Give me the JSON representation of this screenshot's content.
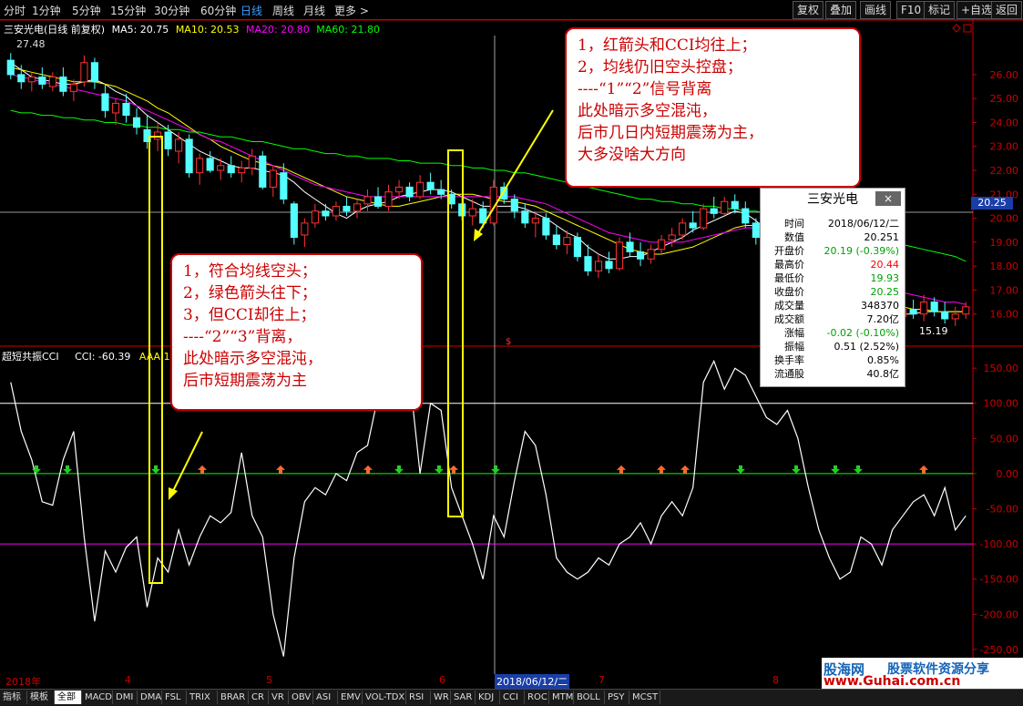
{
  "toolbar": {
    "periods": [
      "分时",
      "1分钟",
      "5分钟",
      "15分钟",
      "30分钟",
      "60分钟",
      "日线",
      "周线",
      "月线",
      "更多 >"
    ],
    "active_period": "日线",
    "buttons": [
      "复权",
      "叠加",
      "画线",
      "F10",
      "标记",
      "+自选",
      "返回"
    ]
  },
  "stock_info": {
    "name_label": "三安光电(日线 前复权)",
    "ma5": "MA5: 20.75",
    "ma10": "MA10: 20.53",
    "ma20": "MA20: 20.80",
    "ma60": "MA60: 21.80",
    "high_mark": "27.48",
    "low_mark": "15.19",
    "current_price": "20.25",
    "arrow_marker": "$"
  },
  "colors": {
    "up": "#ff3232",
    "down": "#54ffff",
    "ma5": "#ffffff",
    "ma10": "#ffff00",
    "ma20": "#ff00ff",
    "ma60": "#00ff00",
    "cci": "#ffffff",
    "note_border": "#cc0000",
    "highlight": "#ffff00"
  },
  "price_axis": [
    "26.00",
    "25.00",
    "24.00",
    "23.00",
    "22.00",
    "21.00",
    "20.00",
    "19.00",
    "18.00",
    "17.00",
    "16.00"
  ],
  "indicator": {
    "name": "超短共振CCI",
    "cci_value": "CCI: -60.39",
    "aaa_value": "AAA:1",
    "axis": [
      "150.00",
      "100.00",
      "50.00",
      "0.00",
      "-50.00",
      "-100.00",
      "-150.00",
      "-200.00",
      "-250.00"
    ]
  },
  "chart_data": {
    "type": "candlestick+line",
    "price_range": [
      15,
      27.48
    ],
    "cci_range": [
      -280,
      180
    ],
    "cci_reference_lines": [
      100,
      0,
      -100
    ],
    "candles": [
      [
        26.6,
        26.9,
        25.8,
        26.0
      ],
      [
        26.0,
        26.4,
        25.4,
        25.7
      ],
      [
        25.7,
        26.1,
        25.3,
        25.9
      ],
      [
        25.9,
        26.3,
        25.4,
        25.6
      ],
      [
        25.5,
        26.1,
        25.3,
        25.9
      ],
      [
        25.9,
        26.3,
        25.1,
        25.3
      ],
      [
        25.3,
        25.8,
        24.9,
        25.6
      ],
      [
        25.7,
        26.8,
        25.5,
        26.5
      ],
      [
        26.5,
        26.7,
        25.4,
        25.7
      ],
      [
        25.2,
        25.6,
        24.2,
        24.5
      ],
      [
        24.4,
        25.0,
        23.9,
        24.8
      ],
      [
        24.8,
        25.2,
        24.0,
        24.3
      ],
      [
        24.2,
        24.6,
        23.5,
        23.8
      ],
      [
        23.7,
        24.3,
        22.9,
        23.2
      ],
      [
        23.3,
        24.0,
        22.8,
        23.6
      ],
      [
        23.6,
        23.9,
        22.6,
        22.9
      ],
      [
        22.8,
        23.6,
        22.3,
        23.3
      ],
      [
        23.3,
        23.5,
        21.7,
        21.9
      ],
      [
        21.9,
        22.7,
        21.4,
        22.5
      ],
      [
        22.5,
        22.8,
        21.9,
        22.0
      ],
      [
        22.0,
        22.5,
        21.6,
        22.2
      ],
      [
        22.2,
        22.6,
        21.7,
        21.9
      ],
      [
        21.9,
        22.4,
        21.5,
        22.1
      ],
      [
        22.1,
        22.9,
        21.8,
        22.6
      ],
      [
        22.6,
        22.8,
        21.2,
        21.3
      ],
      [
        21.3,
        22.2,
        20.9,
        22.0
      ],
      [
        21.9,
        22.3,
        20.6,
        20.8
      ],
      [
        20.6,
        20.7,
        18.9,
        19.2
      ],
      [
        19.3,
        20.0,
        18.8,
        19.8
      ],
      [
        19.8,
        20.6,
        19.6,
        20.3
      ],
      [
        20.3,
        20.6,
        19.9,
        20.1
      ],
      [
        20.1,
        20.7,
        19.9,
        20.5
      ],
      [
        20.5,
        20.9,
        20.1,
        20.3
      ],
      [
        20.3,
        20.8,
        20.0,
        20.6
      ],
      [
        20.6,
        21.2,
        20.3,
        20.9
      ],
      [
        20.9,
        21.3,
        20.4,
        20.5
      ],
      [
        20.5,
        21.4,
        20.3,
        21.1
      ],
      [
        21.1,
        21.6,
        20.8,
        21.3
      ],
      [
        21.3,
        21.5,
        20.7,
        20.9
      ],
      [
        20.9,
        21.8,
        20.8,
        21.5
      ],
      [
        21.5,
        21.9,
        21.0,
        21.2
      ],
      [
        21.2,
        21.6,
        20.8,
        21.0
      ],
      [
        21.0,
        21.2,
        20.4,
        20.6
      ],
      [
        20.6,
        20.9,
        19.9,
        20.1
      ],
      [
        20.1,
        20.8,
        19.7,
        20.4
      ],
      [
        20.4,
        20.7,
        19.6,
        19.8
      ],
      [
        19.8,
        21.6,
        19.7,
        21.3
      ],
      [
        21.3,
        21.5,
        20.6,
        20.8
      ],
      [
        20.8,
        21.0,
        20.0,
        20.3
      ],
      [
        20.3,
        20.6,
        19.6,
        19.8
      ],
      [
        19.8,
        20.3,
        19.2,
        20.0
      ],
      [
        20.0,
        20.2,
        19.1,
        19.3
      ],
      [
        19.3,
        19.7,
        18.7,
        18.9
      ],
      [
        18.9,
        19.5,
        18.5,
        19.2
      ],
      [
        19.2,
        19.4,
        18.2,
        18.4
      ],
      [
        18.4,
        18.9,
        17.6,
        17.8
      ],
      [
        17.8,
        18.5,
        17.5,
        18.2
      ],
      [
        18.2,
        18.6,
        17.7,
        17.9
      ],
      [
        17.9,
        19.2,
        17.8,
        19.0
      ],
      [
        19.0,
        19.4,
        18.4,
        18.6
      ],
      [
        18.6,
        19.0,
        18.0,
        18.3
      ],
      [
        18.3,
        18.9,
        18.1,
        18.7
      ],
      [
        18.7,
        19.3,
        18.5,
        19.1
      ],
      [
        19.1,
        19.6,
        18.8,
        19.3
      ],
      [
        19.3,
        20.0,
        19.1,
        19.8
      ],
      [
        19.8,
        20.3,
        19.4,
        19.6
      ],
      [
        19.6,
        20.6,
        19.5,
        20.4
      ],
      [
        20.4,
        20.9,
        20.0,
        20.2
      ],
      [
        20.2,
        20.9,
        20.1,
        20.7
      ],
      [
        20.7,
        21.0,
        20.2,
        20.4
      ],
      [
        20.4,
        20.7,
        19.6,
        19.8
      ],
      [
        19.8,
        20.0,
        18.9,
        19.2
      ],
      [
        19.2,
        19.6,
        17.9,
        18.1
      ],
      [
        18.1,
        18.6,
        17.1,
        17.4
      ],
      [
        17.4,
        17.9,
        16.6,
        16.9
      ],
      [
        16.9,
        17.4,
        16.2,
        16.5
      ],
      [
        16.5,
        17.0,
        15.8,
        16.2
      ],
      [
        16.2,
        16.9,
        15.6,
        16.6
      ],
      [
        16.6,
        17.1,
        16.0,
        16.4
      ],
      [
        16.4,
        16.8,
        15.4,
        15.9
      ],
      [
        15.9,
        16.5,
        15.5,
        16.3
      ],
      [
        16.3,
        16.9,
        15.6,
        16.1
      ],
      [
        16.1,
        16.7,
        15.4,
        16.4
      ],
      [
        16.4,
        16.6,
        15.2,
        15.6
      ],
      [
        15.6,
        16.2,
        15.4,
        15.9
      ],
      [
        15.9,
        16.5,
        15.7,
        16.2
      ],
      [
        16.2,
        16.6,
        15.8,
        16.0
      ],
      [
        16.0,
        16.8,
        15.7,
        16.5
      ],
      [
        16.5,
        16.7,
        15.9,
        16.1
      ],
      [
        16.1,
        16.5,
        15.6,
        15.8
      ],
      [
        15.8,
        16.3,
        15.5,
        16.0
      ],
      [
        16.0,
        16.5,
        15.8,
        16.3
      ]
    ],
    "ma_series": [
      {
        "name": "MA5",
        "values": [
          26.5,
          26.2,
          25.9,
          25.8,
          25.7,
          25.6,
          25.6,
          25.7,
          25.8,
          25.6,
          25.3,
          25.1,
          24.7,
          24.3,
          24.0,
          23.7,
          23.4,
          23.1,
          22.8,
          22.6,
          22.4,
          22.2,
          22.1,
          22.1,
          22.0,
          21.9,
          21.8,
          21.5,
          21.1,
          20.8,
          20.5,
          20.2,
          20.0,
          20.3,
          20.5,
          20.6,
          20.7,
          20.9,
          21.0,
          21.1,
          21.2,
          21.2,
          21.1,
          20.9,
          20.7,
          20.5,
          20.5,
          20.5,
          20.5,
          20.4,
          20.2,
          20.0,
          19.7,
          19.4,
          19.2,
          18.8,
          18.5,
          18.3,
          18.3,
          18.4,
          18.4,
          18.6,
          18.8,
          19.0,
          19.2,
          19.5,
          19.7,
          19.9,
          20.1,
          20.3,
          20.2,
          19.9,
          19.5,
          19.0,
          18.4,
          17.9,
          17.3,
          16.9,
          16.6,
          16.4,
          16.3,
          16.3,
          16.2,
          16.1,
          16.0,
          16.0,
          16.0,
          16.1,
          16.1,
          16.1,
          16.1,
          16.1
        ]
      },
      {
        "name": "MA10",
        "values": [
          26.3,
          26.2,
          26.1,
          26.0,
          25.9,
          25.8,
          25.7,
          25.7,
          25.7,
          25.6,
          25.5,
          25.3,
          25.1,
          24.9,
          24.6,
          24.4,
          24.1,
          23.8,
          23.5,
          23.3,
          23.0,
          22.8,
          22.6,
          22.4,
          22.3,
          22.2,
          22.1,
          21.9,
          21.7,
          21.5,
          21.3,
          21.1,
          20.9,
          20.8,
          20.7,
          20.6,
          20.5,
          20.5,
          20.6,
          20.7,
          20.8,
          20.9,
          21.0,
          21.0,
          21.0,
          20.9,
          20.8,
          20.7,
          20.7,
          20.6,
          20.5,
          20.3,
          20.1,
          19.9,
          19.7,
          19.5,
          19.3,
          19.1,
          18.9,
          18.7,
          18.6,
          18.5,
          18.5,
          18.6,
          18.7,
          18.8,
          19.0,
          19.2,
          19.4,
          19.6,
          19.7,
          19.7,
          19.6,
          19.5,
          19.3,
          19.0,
          18.7,
          18.3,
          17.9,
          17.5,
          17.2,
          16.9,
          16.7,
          16.5,
          16.4,
          16.3,
          16.2,
          16.2,
          16.1,
          16.1,
          16.1,
          16.1
        ]
      },
      {
        "name": "MA20",
        "values": [
          26.0,
          25.9,
          25.8,
          25.7,
          25.6,
          25.5,
          25.4,
          25.3,
          25.2,
          25.1,
          25.0,
          24.9,
          24.7,
          24.5,
          24.3,
          24.1,
          23.9,
          23.7,
          23.5,
          23.3,
          23.2,
          23.0,
          22.8,
          22.6,
          22.4,
          22.2,
          22.0,
          21.8,
          21.6,
          21.4,
          21.3,
          21.2,
          21.1,
          21.0,
          20.9,
          20.9,
          20.9,
          20.9,
          20.9,
          20.9,
          20.9,
          20.9,
          20.9,
          20.9,
          20.9,
          20.9,
          20.9,
          20.9,
          20.9,
          20.8,
          20.7,
          20.6,
          20.4,
          20.2,
          20.0,
          19.8,
          19.6,
          19.4,
          19.3,
          19.2,
          19.1,
          19.0,
          19.0,
          19.0,
          19.0,
          19.1,
          19.2,
          19.3,
          19.4,
          19.5,
          19.6,
          19.6,
          19.6,
          19.5,
          19.4,
          19.2,
          19.0,
          18.8,
          18.5,
          18.2,
          17.9,
          17.6,
          17.4,
          17.2,
          17.0,
          16.9,
          16.8,
          16.7,
          16.6,
          16.5,
          16.5,
          16.4
        ]
      },
      {
        "name": "MA60",
        "values": [
          24.5,
          24.4,
          24.4,
          24.3,
          24.3,
          24.2,
          24.2,
          24.1,
          24.1,
          24.0,
          24.0,
          23.9,
          23.9,
          23.8,
          23.8,
          23.7,
          23.7,
          23.6,
          23.6,
          23.5,
          23.4,
          23.4,
          23.3,
          23.2,
          23.2,
          23.1,
          23.0,
          22.9,
          22.9,
          22.8,
          22.7,
          22.7,
          22.6,
          22.6,
          22.5,
          22.5,
          22.5,
          22.4,
          22.4,
          22.3,
          22.3,
          22.3,
          22.2,
          22.2,
          22.1,
          22.1,
          22.0,
          22.0,
          21.9,
          21.9,
          21.8,
          21.7,
          21.6,
          21.5,
          21.4,
          21.3,
          21.2,
          21.1,
          21.0,
          20.9,
          20.8,
          20.8,
          20.7,
          20.7,
          20.6,
          20.6,
          20.5,
          20.5,
          20.4,
          20.4,
          20.3,
          20.3,
          20.2,
          20.1,
          20.0,
          19.9,
          19.8,
          19.7,
          19.6,
          19.5,
          19.4,
          19.3,
          19.2,
          19.1,
          19.0,
          18.9,
          18.8,
          18.7,
          18.6,
          18.5,
          18.4,
          18.2
        ]
      }
    ],
    "cci": [
      130,
      60,
      20,
      -40,
      -45,
      20,
      60,
      -90,
      -210,
      -110,
      -140,
      -105,
      -90,
      -190,
      -120,
      -140,
      -80,
      -130,
      -90,
      -60,
      -70,
      -55,
      30,
      -60,
      -90,
      -200,
      -260,
      -120,
      -40,
      -20,
      -30,
      0,
      -10,
      30,
      40,
      110,
      130,
      100,
      140,
      0,
      100,
      90,
      -20,
      -60,
      -100,
      -150,
      -60,
      -90,
      -10,
      60,
      40,
      -30,
      -120,
      -140,
      -150,
      -140,
      -120,
      -130,
      -100,
      -90,
      -70,
      -100,
      -60,
      -40,
      -60,
      -20,
      130,
      160,
      120,
      150,
      140,
      110,
      80,
      70,
      90,
      50,
      -20,
      -80,
      -120,
      -150,
      -140,
      -90,
      -100,
      -130,
      -80,
      -60,
      -40,
      -30,
      -60,
      -20,
      -80,
      -60
    ]
  },
  "signals": {
    "green_down_x": [
      40,
      74,
      171,
      438,
      482,
      544,
      813,
      874,
      917,
      942
    ],
    "red_up_x": [
      222,
      308,
      404,
      498,
      682,
      726,
      752,
      1014
    ]
  },
  "notes": {
    "right": [
      "1，红箭头和CCI均往上；",
      "2，均线仍旧空头控盘；",
      "----“1”“2”信号背离",
      "此处暗示多空混沌，",
      "后市几日内短期震荡为主，",
      "大多没啥大方向"
    ],
    "left": [
      "1，符合均线空头；",
      "2，绿色箭头往下；",
      "3，但CCI却往上；",
      "----“2”“3”背离，",
      "此处暗示多空混沌，",
      "后市短期震荡为主"
    ]
  },
  "popup": {
    "title": "三安光电",
    "close": "×",
    "rows": [
      {
        "k": "时间",
        "v": "2018/06/12/二",
        "c": "#000000"
      },
      {
        "k": "数值",
        "v": "20.251",
        "c": "#000000"
      },
      {
        "k": "开盘价",
        "v": "20.19 (-0.39%)",
        "c": "#00a000"
      },
      {
        "k": "最高价",
        "v": "20.44",
        "c": "#ff0000"
      },
      {
        "k": "最低价",
        "v": "19.93",
        "c": "#00a000"
      },
      {
        "k": "收盘价",
        "v": "20.25",
        "c": "#00a000"
      },
      {
        "k": "成交量",
        "v": "348370",
        "c": "#000000"
      },
      {
        "k": "成交额",
        "v": "7.20亿",
        "c": "#000000"
      },
      {
        "k": "涨幅",
        "v": "-0.02 (-0.10%)",
        "c": "#00a000"
      },
      {
        "k": "振幅",
        "v": "0.51 (2.52%)",
        "c": "#000000"
      },
      {
        "k": "换手率",
        "v": "0.85%",
        "c": "#000000"
      },
      {
        "k": "流通股",
        "v": "40.8亿",
        "c": "#000000"
      }
    ]
  },
  "date_axis": {
    "labels": [
      "2018年",
      "4",
      "5",
      "6",
      "7",
      "8"
    ],
    "cursor_date": "2018/06/12/二"
  },
  "tabs": [
    "指标",
    "模板",
    "全部",
    "MACD",
    "DMI",
    "DMA",
    "FSL",
    "TRIX",
    "BRAR",
    "CR",
    "VR",
    "OBV",
    "ASI",
    "EMV",
    "VOL-TDX",
    "RSI",
    "WR",
    "SAR",
    "KDJ",
    "CCI",
    "ROC",
    "MTM",
    "BOLL",
    "PSY",
    "MCST"
  ],
  "active_tab": "全部",
  "watermark": {
    "brand": "股海网",
    "slogan": "股票软件资源分享",
    "url": "www.Guhai.com.cn"
  }
}
